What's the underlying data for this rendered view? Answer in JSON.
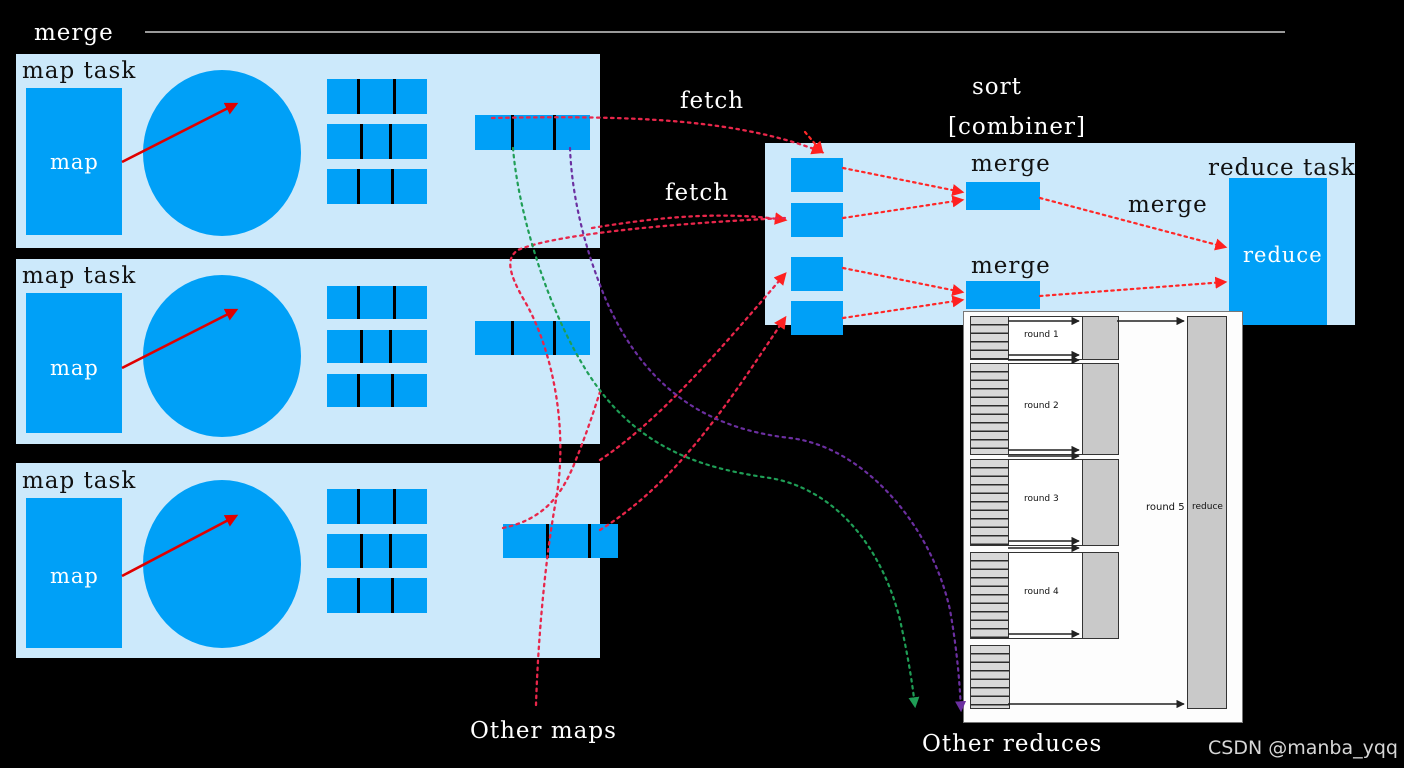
{
  "header": {
    "merge_label": "merge"
  },
  "map_tasks": [
    {
      "title": "map task",
      "map_label": "map"
    },
    {
      "title": "map task",
      "map_label": "map"
    },
    {
      "title": "map task",
      "map_label": "map"
    }
  ],
  "fetch_labels": [
    "fetch",
    "fetch"
  ],
  "reduce_side": {
    "sort_label": "sort",
    "combiner_label": "[combiner]",
    "title": "reduce task",
    "reduce_label": "reduce",
    "merge_labels": [
      "merge",
      "merge",
      "merge"
    ]
  },
  "bottom_labels": {
    "other_maps": "Other maps",
    "other_reduces": "Other reduces"
  },
  "embedded_figure": {
    "rounds": [
      "round 1",
      "round 2",
      "round 3",
      "round 4"
    ],
    "round5": "round 5",
    "reduce": "reduce"
  },
  "watermark": "CSDN @manba_yqq",
  "colors": {
    "background": "#000000",
    "panel": "#cce9fb",
    "accent_blue": "#00a0f7",
    "arrow_red": "#ff0000",
    "flow_red": "#e8264a",
    "flow_green": "#1f9e56",
    "flow_purple": "#6b2fa0",
    "rule_gray": "#9a9a9a"
  }
}
